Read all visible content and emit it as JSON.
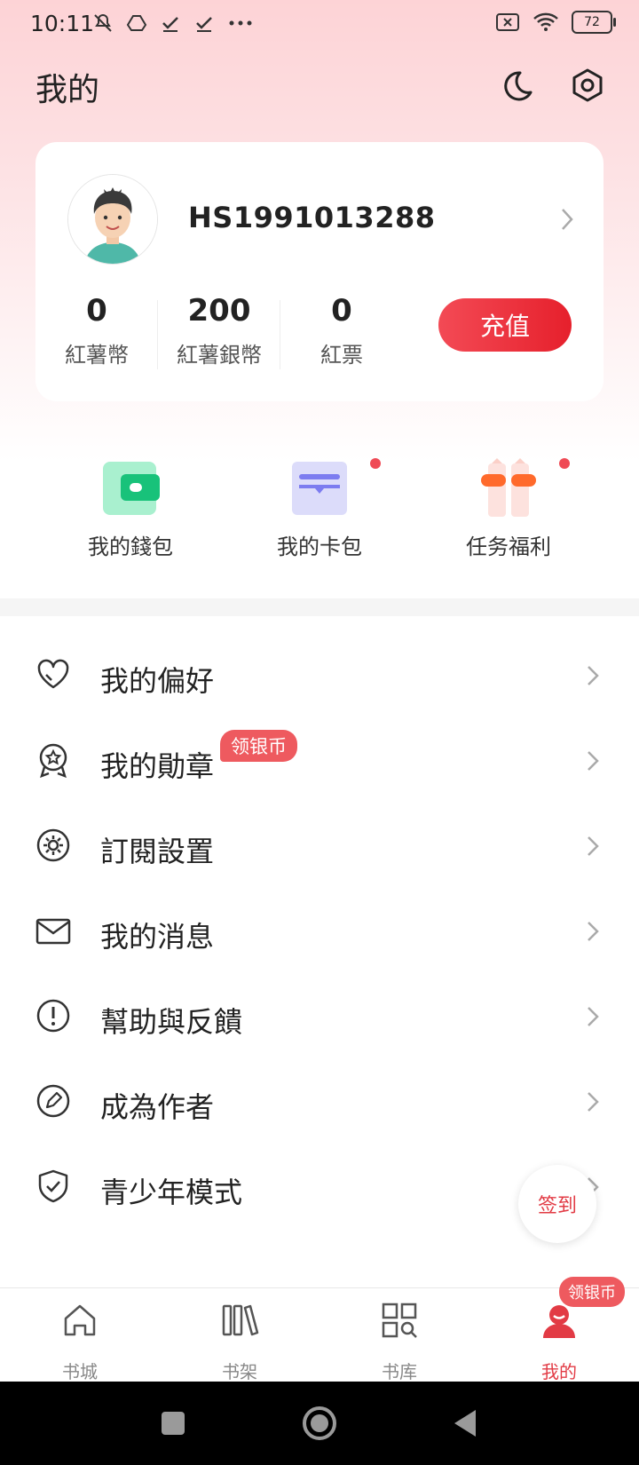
{
  "status_bar": {
    "time": "10:11",
    "battery": "72"
  },
  "header": {
    "title": "我的"
  },
  "profile": {
    "username": "HS1991013288",
    "stats": [
      {
        "value": "0",
        "label": "紅薯幣"
      },
      {
        "value": "200",
        "label": "紅薯銀幣"
      },
      {
        "value": "0",
        "label": "紅票"
      }
    ],
    "recharge_label": "充值"
  },
  "quick_actions": [
    {
      "label": "我的錢包",
      "icon": "wallet-icon"
    },
    {
      "label": "我的卡包",
      "icon": "card-holder-icon"
    },
    {
      "label": "任务福利",
      "icon": "gift-icon"
    }
  ],
  "menu": [
    {
      "label": "我的偏好",
      "icon": "heart-icon"
    },
    {
      "label": "我的勛章",
      "icon": "medal-icon",
      "badge": "领银币"
    },
    {
      "label": "訂閱設置",
      "icon": "settings-icon"
    },
    {
      "label": "我的消息",
      "icon": "mail-icon"
    },
    {
      "label": "幫助與反饋",
      "icon": "help-icon"
    },
    {
      "label": "成為作者",
      "icon": "pen-icon"
    },
    {
      "label": "青少年模式",
      "icon": "shield-icon"
    }
  ],
  "sign_in": "签到",
  "bottom_nav": [
    {
      "label": "书城",
      "icon": "home-icon"
    },
    {
      "label": "书架",
      "icon": "bookshelf-icon"
    },
    {
      "label": "书库",
      "icon": "library-icon"
    },
    {
      "label": "我的",
      "icon": "profile-icon",
      "badge": "领银币"
    }
  ],
  "colors": {
    "accent": "#e23b45",
    "badge": "#ee5a5f"
  }
}
